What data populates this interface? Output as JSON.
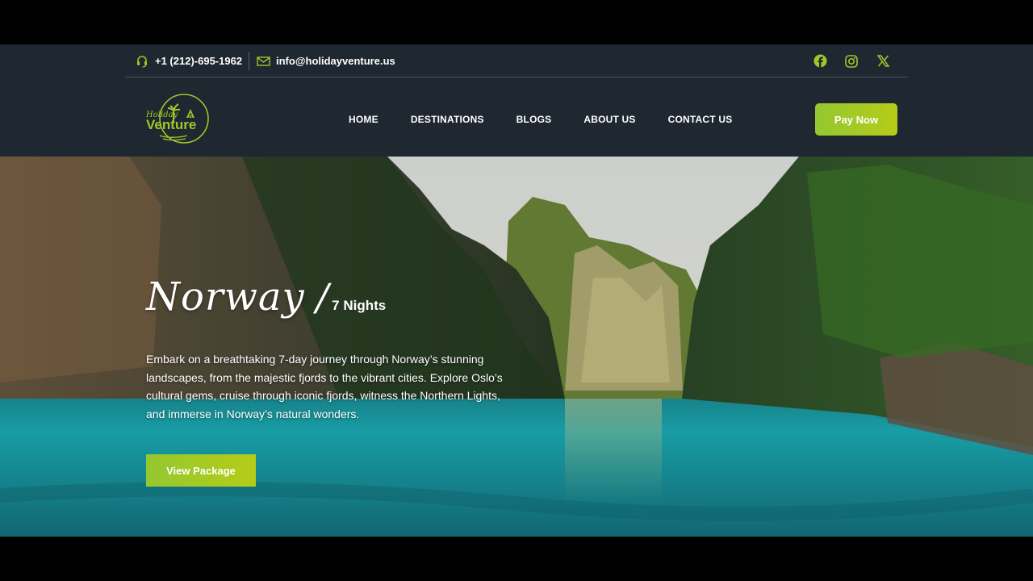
{
  "topbar": {
    "phone": "+1 (212)-695-1962",
    "email": "info@holidayventure.us",
    "socials": [
      "facebook-icon",
      "instagram-icon",
      "x-icon"
    ]
  },
  "logo": {
    "script_text": "Holiday",
    "main_text": "Venture"
  },
  "nav": {
    "items": [
      "HOME",
      "DESTINATIONS",
      "BLOGS",
      "ABOUT US",
      "CONTACT US"
    ],
    "pay_label": "Pay Now"
  },
  "hero": {
    "destination": "Norway",
    "slash": "/",
    "duration": "7 Nights",
    "description": "Embark on a breathtaking 7-day journey through Norway’s stunning landscapes, from the majestic fjords to the vibrant cities. Explore Oslo’s cultural gems, cruise through iconic fjords, witness the Northern Lights, and immerse in Norway’s natural wonders.",
    "cta_label": "View Package"
  },
  "colors": {
    "header_bg": "#1f2731",
    "accent_green": "#9ec82a",
    "letterbox": "#000000"
  }
}
